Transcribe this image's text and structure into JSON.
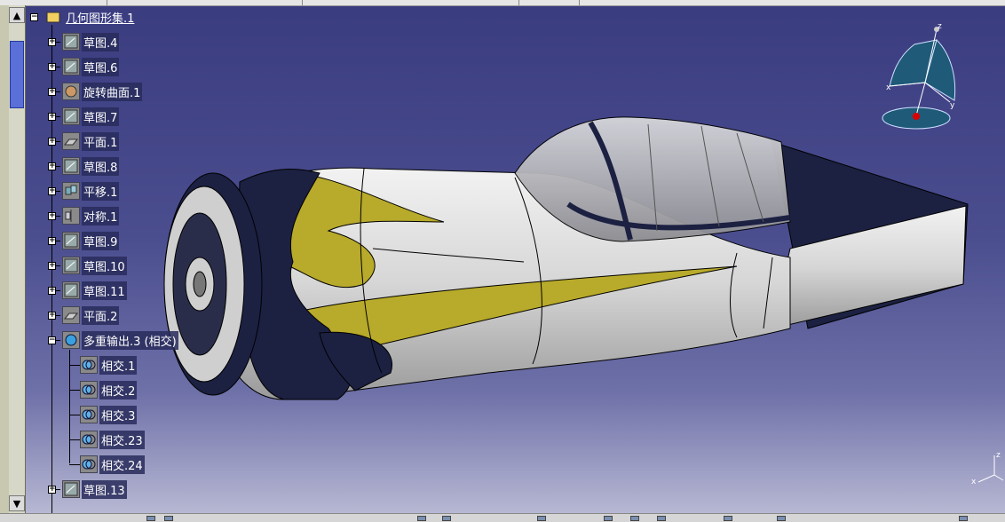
{
  "tree": {
    "root": {
      "label": "几何图形集.1",
      "icon": "geometric-set-icon"
    },
    "items": [
      {
        "label": "草图.4",
        "icon": "sketch-icon"
      },
      {
        "label": "草图.6",
        "icon": "sketch-icon"
      },
      {
        "label": "旋转曲面.1",
        "icon": "revolve-surface-icon"
      },
      {
        "label": "草图.7",
        "icon": "sketch-icon"
      },
      {
        "label": "平面.1",
        "icon": "plane-icon"
      },
      {
        "label": "草图.8",
        "icon": "sketch-icon"
      },
      {
        "label": "平移.1",
        "icon": "translate-icon"
      },
      {
        "label": "对称.1",
        "icon": "symmetry-icon"
      },
      {
        "label": "草图.9",
        "icon": "sketch-icon"
      },
      {
        "label": "草图.10",
        "icon": "sketch-icon"
      },
      {
        "label": "草图.11",
        "icon": "sketch-icon"
      },
      {
        "label": "平面.2",
        "icon": "plane-icon"
      },
      {
        "label": "多重输出.3 (相交)",
        "icon": "multi-output-icon"
      }
    ],
    "children": [
      {
        "label": "相交.1",
        "icon": "intersect-icon"
      },
      {
        "label": "相交.2",
        "icon": "intersect-icon"
      },
      {
        "label": "相交.3",
        "icon": "intersect-icon"
      },
      {
        "label": "相交.23",
        "icon": "intersect-icon"
      },
      {
        "label": "相交.24",
        "icon": "intersect-icon"
      }
    ],
    "after": [
      {
        "label": "草图.13",
        "icon": "sketch-icon"
      }
    ]
  },
  "compass": {
    "x": "x",
    "y": "y",
    "z": "z"
  },
  "axes": {
    "x": "x",
    "z": "z"
  },
  "colors": {
    "background_top": "#3a3c80",
    "background_bottom": "#bcbdd6",
    "body": "#d9d9d9",
    "navy": "#1c2142",
    "gold": "#b8aa2a"
  }
}
